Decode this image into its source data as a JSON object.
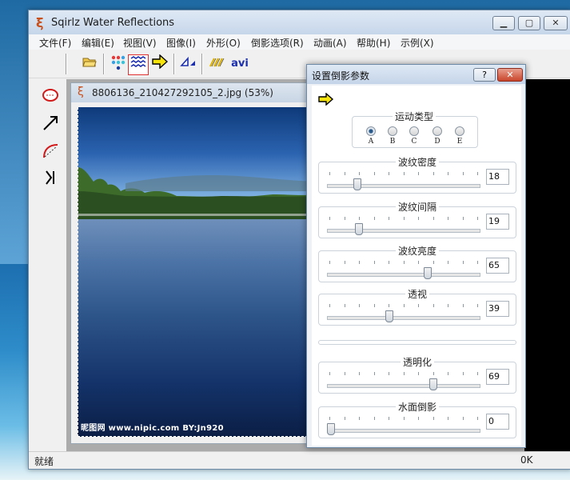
{
  "app": {
    "title": "Sqirlz Water Reflections"
  },
  "menu": [
    "文件(F)",
    "编辑(E)",
    "视图(V)",
    "图像(I)",
    "外形(O)",
    "倒影选项(R)",
    "动画(A)",
    "帮助(H)",
    "示例(X)"
  ],
  "toolbar": {
    "avi_label": "avi"
  },
  "document": {
    "title": "8806136_210427292105_2.jpg  (53%)",
    "watermark": "昵图网 www.nipic.com   BY:Jn920"
  },
  "status": {
    "left": "就绪",
    "right": "0K"
  },
  "dialog": {
    "title": "设置倒影参数",
    "motion": {
      "label": "运动类型",
      "options": [
        "A",
        "B",
        "C",
        "D",
        "E"
      ],
      "selected": "A"
    },
    "sliders": [
      {
        "label": "波纹密度",
        "value": "18"
      },
      {
        "label": "波纹间隔",
        "value": "19"
      },
      {
        "label": "波纹亮度",
        "value": "65"
      },
      {
        "label": "透视",
        "value": "39"
      },
      {
        "label": "透明化",
        "value": "69"
      },
      {
        "label": "水面倒影",
        "value": "0"
      }
    ]
  },
  "colors": {
    "accent": "#c8501c",
    "close": "#c9452b"
  }
}
